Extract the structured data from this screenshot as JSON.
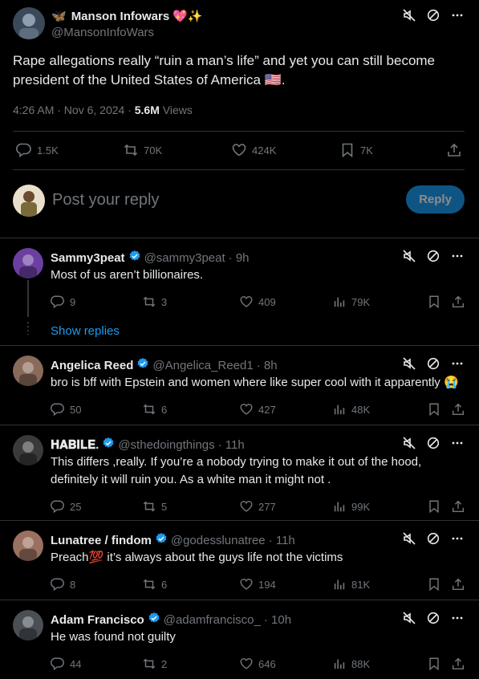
{
  "tweet": {
    "author_name": "Manson Infowars",
    "author_name_emoji": "🦋",
    "author_name_suffix": "💖✨",
    "author_handle": "@MansonInfoWars",
    "text_line1": "Rape allegations really “ruin a man’s life” and yet you can still become",
    "text_line2": "president of the United States of America 🇺🇸.",
    "time": "4:26 AM · Nov 6, 2024 · ",
    "views_count": "5.6M",
    "views_label": " Views",
    "stats": {
      "replies": "1.5K",
      "reposts": "70K",
      "likes": "424K",
      "bookmarks": "7K"
    }
  },
  "composer": {
    "placeholder": "Post your reply",
    "button": "Reply"
  },
  "replies": [
    {
      "name": "Sammy3peat",
      "handle": "@sammy3peat",
      "time": "· 9h",
      "text": [
        "Most of us aren’t billionaires."
      ],
      "replies": "9",
      "reposts": "3",
      "likes": "409",
      "views": "79K",
      "show_replies": "Show replies",
      "avatar_color": "#6b3fa0"
    },
    {
      "name": "Angelica Reed",
      "handle": "@Angelica_Reed1",
      "time": "· 8h",
      "text": [
        "bro is bff with Epstein and women where like super cool with it apparently 😭"
      ],
      "replies": "50",
      "reposts": "6",
      "likes": "427",
      "views": "48K",
      "avatar_color": "#8a6a5a"
    },
    {
      "name": "𝐇𝐀𝐁𝐈𝐋𝐄.",
      "handle": "@sthedoingthings",
      "time": "· 11h",
      "text": [
        "This differs ,really. If you’re a nobody trying to make it out of the hood,",
        "definitely it will ruin you. As a white man it might not ."
      ],
      "replies": "25",
      "reposts": "5",
      "likes": "277",
      "views": "99K",
      "avatar_color": "#3a3a3a"
    },
    {
      "name": "Lunatree / findom",
      "handle": "@godesslunatree",
      "time": "· 11h",
      "text": [
        "Preach💯 it’s always about the guys life not the victims"
      ],
      "replies": "8",
      "reposts": "6",
      "likes": "194",
      "views": "81K",
      "avatar_color": "#9a7060"
    },
    {
      "name": "Adam Francisco",
      "handle": "@adamfrancisco_",
      "time": "· 10h",
      "text": [
        "He was found not guilty"
      ],
      "replies": "44",
      "reposts": "2",
      "likes": "646",
      "views": "88K",
      "avatar_color": "#4a4f55"
    }
  ],
  "colors": {
    "accent": "#1d9bf0",
    "muted": "#71767b",
    "border": "#2f3336",
    "background": "#000000"
  },
  "icons": [
    "mute-icon",
    "block-icon",
    "more-icon",
    "reply-icon",
    "repost-icon",
    "like-icon",
    "bookmark-icon",
    "share-icon",
    "views-icon",
    "verified-icon"
  ]
}
